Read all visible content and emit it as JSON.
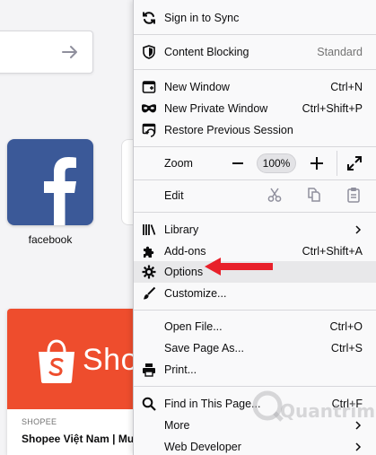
{
  "background": {
    "top_site": {
      "label": "facebook"
    },
    "highlight_card": {
      "brand_text": "Sho",
      "source": "SHOPEE",
      "title": "Shopee Việt Nam | Mua"
    }
  },
  "menu": {
    "sync": {
      "label": "Sign in to Sync",
      "icon": "sync-icon"
    },
    "content_blocking": {
      "label": "Content Blocking",
      "value": "Standard",
      "icon": "shield-icon"
    },
    "new_window": {
      "label": "New Window",
      "shortcut": "Ctrl+N",
      "icon": "new-window-icon"
    },
    "new_private_window": {
      "label": "New Private Window",
      "shortcut": "Ctrl+Shift+P",
      "icon": "private-mask-icon"
    },
    "restore_session": {
      "label": "Restore Previous Session",
      "icon": "restore-session-icon"
    },
    "zoom": {
      "label": "Zoom",
      "level": "100%",
      "icons": [
        "zoom-out-icon",
        "zoom-in-icon",
        "fullscreen-icon"
      ]
    },
    "edit": {
      "label": "Edit",
      "icons": [
        "cut-icon",
        "copy-icon",
        "paste-icon"
      ]
    },
    "library": {
      "label": "Library",
      "icon": "library-icon"
    },
    "addons": {
      "label": "Add-ons",
      "shortcut": "Ctrl+Shift+A",
      "icon": "puzzle-icon"
    },
    "options": {
      "label": "Options",
      "icon": "gear-icon"
    },
    "customize": {
      "label": "Customize...",
      "icon": "paintbrush-icon"
    },
    "open_file": {
      "label": "Open File...",
      "shortcut": "Ctrl+O"
    },
    "save_page": {
      "label": "Save Page As...",
      "shortcut": "Ctrl+S"
    },
    "print": {
      "label": "Print...",
      "icon": "printer-icon"
    },
    "find": {
      "label": "Find in This Page...",
      "shortcut": "Ctrl+F",
      "icon": "search-icon"
    },
    "more": {
      "label": "More"
    },
    "web_developer": {
      "label": "Web Developer"
    }
  },
  "annotation": {
    "arrow_color": "#e8202a",
    "pointer_icon": "red-arrow-icon"
  },
  "watermark": {
    "text": "Quantrimang"
  },
  "colors": {
    "facebook": "#3b5998",
    "shopee": "#ee4d2d",
    "menu_bg": "#f9f9fa"
  }
}
